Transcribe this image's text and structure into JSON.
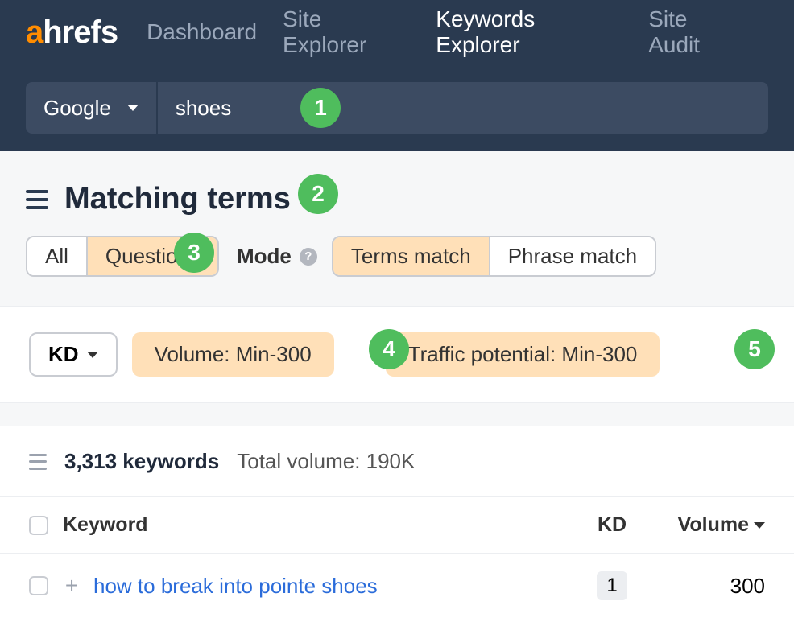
{
  "logo": {
    "first": "a",
    "rest": "hrefs"
  },
  "nav": {
    "dashboard": "Dashboard",
    "site_explorer": "Site Explorer",
    "keywords_explorer": "Keywords Explorer",
    "site_audit": "Site Audit"
  },
  "search": {
    "engine": "Google",
    "query": "shoes"
  },
  "section": {
    "title": "Matching terms"
  },
  "type_tabs": {
    "all": "All",
    "questions": "Questions"
  },
  "mode": {
    "label": "Mode",
    "terms_match": "Terms match",
    "phrase_match": "Phrase match"
  },
  "filters": {
    "kd_btn": "KD",
    "volume_pill": "Volume: Min-300",
    "tp_pill": "Traffic potential: Min-300"
  },
  "summary": {
    "count": "3,313 keywords",
    "total_volume": "Total volume: 190K"
  },
  "table": {
    "headers": {
      "keyword": "Keyword",
      "kd": "KD",
      "volume": "Volume"
    },
    "rows": [
      {
        "keyword": "how to break into pointe shoes",
        "kd": "1",
        "volume": "300"
      }
    ]
  },
  "badges": [
    "1",
    "2",
    "3",
    "4",
    "5"
  ]
}
